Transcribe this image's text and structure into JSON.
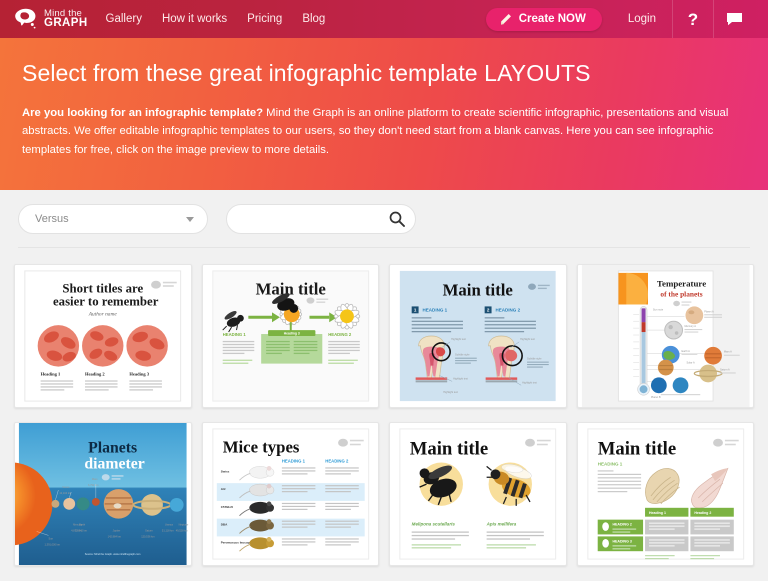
{
  "navbar": {
    "logo": {
      "icon": "brain-icon",
      "line1": "Mind the",
      "line2": "GRAPH"
    },
    "links": [
      {
        "label": "Gallery"
      },
      {
        "label": "How it works"
      },
      {
        "label": "Pricing"
      },
      {
        "label": "Blog"
      }
    ],
    "create_button": {
      "label": "Create NOW",
      "icon": "pencil-icon",
      "color": "#e8226b"
    },
    "login_label": "Login",
    "help_icon": "question-mark-icon",
    "chat_icon": "chat-bubble-icon",
    "background_start": "#b52234",
    "background_end": "#cf2062"
  },
  "hero": {
    "title": "Select from these great infographic template LAYOUTS",
    "body_bold": "Are you looking for an infographic template?",
    "body": " Mind the Graph is an online platform to create scientific infographic, presentations and visual abstracts. We offer editable infographic templates to our users, so they don't need start from a blank canvas. Here you can see infographic templates for free, click on the image preview to more details.",
    "gradient_start": "#f4743b",
    "gradient_end": "#e8317a"
  },
  "filters": {
    "category_select": {
      "value": "Versus",
      "icon": "chevron-down-icon"
    },
    "search": {
      "value": "",
      "placeholder": "",
      "icon": "search-icon"
    }
  },
  "templates": [
    {
      "id": "short-titles",
      "title_line1": "Short titles are",
      "title_line2": "easier to remember",
      "subtitle": "Author name",
      "headings": [
        "Heading 1",
        "Heading 2",
        "Heading 3"
      ],
      "body": "Paragraph title. Lorem ipsum dolor sit amet, consectetur adipiscing elit, sed tempor aliquam.",
      "style": "blood-cells-white"
    },
    {
      "id": "bee-daisy",
      "title": "Main title",
      "headings": [
        "HEADING 1",
        "HEADING 2"
      ],
      "center_heading": "Heading 3",
      "body": "Paragraph title. Lorem ipsum dolor sit amet, consectetur adipiscing elit, sed tempor aliquam.",
      "style": "green-boxes-white"
    },
    {
      "id": "tooth-anatomy",
      "title": "Main title",
      "headings": [
        "HEADING 1",
        "HEADING 2"
      ],
      "callouts": [
        "Highlight text",
        "Subtitle style"
      ],
      "body": "Paragraph style. Lorem ipsum dolor sit amet, consectetur adipiscing elit.",
      "style": "light-blue"
    },
    {
      "id": "planet-temperature",
      "title_line1": "Temperature",
      "title_line2": "of the planets",
      "style": "portrait-white"
    },
    {
      "id": "planets-diameter",
      "title_line1": "Planets",
      "title_line2": "diameter",
      "style": "blue-space"
    },
    {
      "id": "mice-types",
      "title": "Mice types",
      "headings": [
        "HEADING 1",
        "HEADING 2"
      ],
      "rows": [
        "Swiss",
        "A/J",
        "C57BL/6",
        "DBA",
        "Peromyscus leucopus"
      ],
      "style": "striped-table-white"
    },
    {
      "id": "bee-species",
      "title": "Main title",
      "headings": [
        "Melipona scutellaris",
        "Apis mellifera"
      ],
      "body": "Paragraph style. Lorem ipsum dolor sit amet, consectetur adipiscing elit, sed tempor aliquam.",
      "style": "two-bees-white"
    },
    {
      "id": "seashells",
      "title": "Main title",
      "headings": [
        "HEADING 1",
        "HEADING 2",
        "HEADING 3"
      ],
      "column_headings": [
        "Heading 1",
        "Heading 2"
      ],
      "body": "Paragraph style. Lorem ipsum dolor sit amet, consectetur adipiscing elit.",
      "style": "green-grid-white"
    }
  ]
}
